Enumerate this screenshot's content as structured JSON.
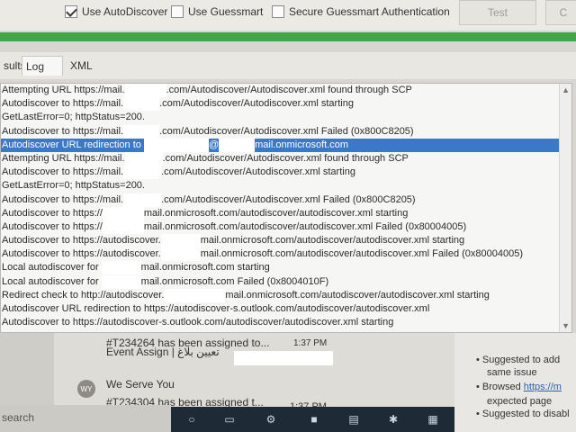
{
  "options": {
    "use_autodiscover": {
      "label": "Use AutoDiscover",
      "checked": true
    },
    "use_guessmart": {
      "label": "Use Guessmart",
      "checked": false
    },
    "secure_guessmart": {
      "label": "Secure Guessmart Authentication",
      "checked": false
    },
    "test_button": "Test",
    "cancel_button": "C"
  },
  "progress": {
    "percent": 100,
    "color": "#3fa64a"
  },
  "tabs": [
    {
      "label": "sults"
    },
    {
      "label": "Log",
      "active": true
    },
    {
      "label": "XML"
    }
  ],
  "log": {
    "lines": [
      {
        "pre": "Attempting URL https://mail.",
        "post": ".com/Autodiscover/Autodiscover.xml found through SCP"
      },
      {
        "pre": "Autodiscover to https://mail.",
        "post": ".com/Autodiscover/Autodiscover.xml starting"
      },
      {
        "pre": "GetLastError=0; httpStatus=200.",
        "post": ""
      },
      {
        "pre": "Autodiscover to https://mail.",
        "post": ".com/Autodiscover/Autodiscover.xml Failed (0x800C8205)"
      },
      {
        "pre": "Autodiscover URL redirection to ",
        "post": "mail.onmicrosoft.com",
        "mid": "@",
        "selected": true
      },
      {
        "pre": "Attempting URL https://mail.",
        "post": ".com/Autodiscover/Autodiscover.xml found through SCP"
      },
      {
        "pre": "Autodiscover to https://mail.",
        "post": ".com/Autodiscover/Autodiscover.xml starting"
      },
      {
        "pre": "GetLastError=0; httpStatus=200.",
        "post": ""
      },
      {
        "pre": "Autodiscover to https://mail.",
        "post": ".com/Autodiscover/Autodiscover.xml Failed (0x800C8205)"
      },
      {
        "pre": "Autodiscover to https://",
        "post": "mail.onmicrosoft.com/autodiscover/autodiscover.xml starting"
      },
      {
        "pre": "Autodiscover to https://",
        "post": "mail.onmicrosoft.com/autodiscover/autodiscover.xml Failed (0x80004005)"
      },
      {
        "pre": "Autodiscover to https://autodiscover.",
        "post": "mail.onmicrosoft.com/autodiscover/autodiscover.xml starting"
      },
      {
        "pre": "Autodiscover to https://autodiscover.",
        "post": "mail.onmicrosoft.com/autodiscover/autodiscover.xml Failed (0x80004005)"
      },
      {
        "pre": "Local autodiscover for ",
        "post": "mail.onmicrosoft.com starting"
      },
      {
        "pre": "Local autodiscover for ",
        "post": "mail.onmicrosoft.com Failed (0x8004010F)"
      },
      {
        "pre": "Redirect check to http://autodiscover.",
        "post": "mail.onmicrosoft.com/autodiscover/autodiscover.xml starting"
      },
      {
        "pre": "Autodiscover URL redirection to https://autodiscover-s.outlook.com/autodiscover/autodiscover.xml",
        "post": ""
      },
      {
        "pre": "Autodiscover to https://autodiscover-s.outlook.com/autodiscover/autodiscover.xml starting",
        "post": ""
      }
    ]
  },
  "mail": {
    "item1_subject": "#T234264 has been assigned to...",
    "item1_time": "1:37 PM",
    "item1_preview": "Event Assign | تعيين بلاغ",
    "item2_avatar": "WY",
    "item2_sender": "We Serve You",
    "item2_subject": "#T234304 has been assigned t...",
    "item2_time": "1:37 PM"
  },
  "side_panel": {
    "b1a": "Suggested to add",
    "b1b": "same issue",
    "b2a": "Browsed ",
    "b2link": "https://m",
    "b2b": "expected page",
    "b3a": "Suggested to disabl"
  },
  "search_label": "search"
}
